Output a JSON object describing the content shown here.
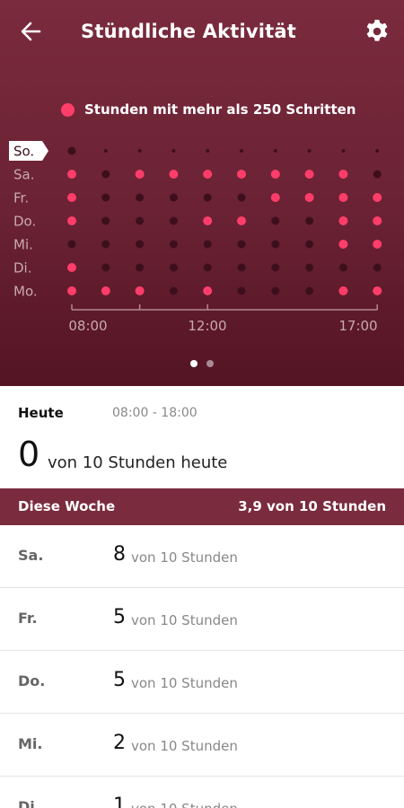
{
  "header": {
    "title": "Stündliche Aktivität",
    "back_icon": "arrow-left-icon",
    "settings_icon": "gear-icon"
  },
  "legend": {
    "label": "Stunden mit mehr als 250 Schritten",
    "color": "#ff3d6a"
  },
  "chart_data": {
    "type": "heatmap",
    "title": "",
    "rows": [
      "So.",
      "Sa.",
      "Fr.",
      "Do.",
      "Mi.",
      "Di.",
      "Mo."
    ],
    "selected_row": "So.",
    "x_tick_labels": [
      "08:00",
      "12:00",
      "17:00"
    ],
    "hours": [
      8,
      9,
      10,
      11,
      12,
      13,
      14,
      15,
      16,
      17
    ],
    "active": [
      [
        0,
        0,
        0,
        0,
        0,
        0,
        0,
        0,
        0,
        0
      ],
      [
        1,
        0,
        1,
        1,
        1,
        1,
        1,
        1,
        1,
        0
      ],
      [
        1,
        0,
        0,
        0,
        0,
        0,
        1,
        1,
        1,
        1
      ],
      [
        1,
        0,
        0,
        0,
        1,
        1,
        0,
        0,
        1,
        1
      ],
      [
        0,
        0,
        0,
        0,
        0,
        0,
        0,
        0,
        1,
        1
      ],
      [
        1,
        0,
        0,
        0,
        0,
        0,
        0,
        0,
        0,
        0
      ],
      [
        1,
        1,
        1,
        0,
        1,
        0,
        0,
        0,
        1,
        1
      ]
    ],
    "colors": {
      "active": "#ff3d6a",
      "inactive": "#3d0f1c"
    }
  },
  "pager": {
    "active_color": "#ffffff",
    "inactive_color": "#a88a92"
  },
  "today": {
    "label": "Heute",
    "time_range": "08:00 - 18:00",
    "value": "0",
    "suffix": "von 10 Stunden heute"
  },
  "week": {
    "label": "Diese Woche",
    "total": "3,9 von 10 Stunden"
  },
  "days": [
    {
      "name": "Sa.",
      "count": "8",
      "suffix": "von 10 Stunden"
    },
    {
      "name": "Fr.",
      "count": "5",
      "suffix": "von 10 Stunden"
    },
    {
      "name": "Do.",
      "count": "5",
      "suffix": "von 10 Stunden"
    },
    {
      "name": "Mi.",
      "count": "2",
      "suffix": "von 10 Stunden"
    },
    {
      "name": "Di.",
      "count": "1",
      "suffix": "von 10 Stunden"
    }
  ]
}
